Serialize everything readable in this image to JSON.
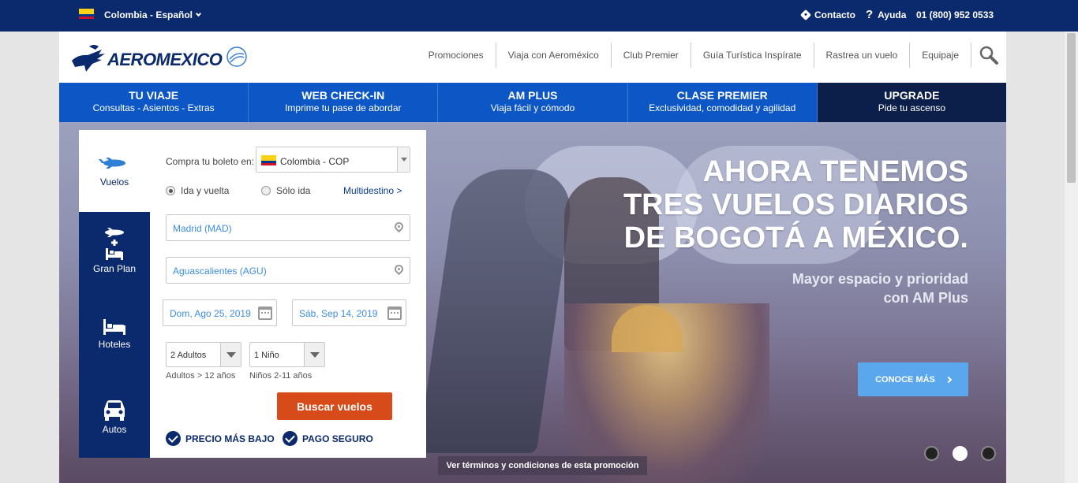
{
  "topbar": {
    "country_label": "Colombia - Español",
    "contact_label": "Contacto",
    "help_label": "Ayuda",
    "phone": "01 (800) 952 0533"
  },
  "header": {
    "logo_text": "AEROMEXICO",
    "nav": [
      "Promociones",
      "Viaja con Aeroméxico",
      "Club Premier",
      "Guía Turística Inspírate",
      "Rastrea un vuelo",
      "Equipaje"
    ]
  },
  "tabs": [
    {
      "title": "TU VIAJE",
      "subtitle": "Consultas - Asientos - Extras"
    },
    {
      "title": "WEB CHECK-IN",
      "subtitle": "Imprime tu pase de abordar"
    },
    {
      "title": "AM PLUS",
      "subtitle": "Viaja fácil y cómodo"
    },
    {
      "title": "CLASE PREMIER",
      "subtitle": "Exclusividad, comodidad y agilidad"
    },
    {
      "title": "UPGRADE",
      "subtitle": "Pide tu ascenso"
    }
  ],
  "booking": {
    "side_tabs": [
      "Vuelos",
      "Gran Plan",
      "Hoteles",
      "Autos"
    ],
    "buy_label": "Compra tu boleto en:",
    "country_value": "Colombia - COP",
    "trip_round": "Ida y vuelta",
    "trip_one_way": "Sólo ida",
    "multi": "Multidestino >",
    "origin": "Madrid (MAD)",
    "destination": "Aguascalientes (AGU)",
    "depart_date": "Dom, Ago 25, 2019",
    "return_date": "Sáb, Sep 14, 2019",
    "adults": "2 Adultos",
    "children": "1 Niño",
    "adults_hint": "Adultos > 12 años",
    "children_hint": "Niños 2-11 años",
    "search_button": "Buscar vuelos",
    "badge_price": "PRECIO MÁS BAJO",
    "badge_secure": "PAGO SEGURO"
  },
  "hero": {
    "headline_1": "AHORA TENEMOS",
    "headline_2": "TRES VUELOS DIARIOS",
    "headline_3": "DE BOGOTÁ A MÉXICO.",
    "sub_1": "Mayor espacio y prioridad",
    "sub_2": "con AM Plus",
    "more_button": "CONOCE MÁS",
    "terms_link": "Ver términos y condiciones de esta promoción",
    "active_slide": 2
  },
  "colors": {
    "navy": "#0b2a6e",
    "blue_tab": "#0c57c5",
    "cta_orange": "#d64b19",
    "light_blue": "#5aa7ee"
  }
}
